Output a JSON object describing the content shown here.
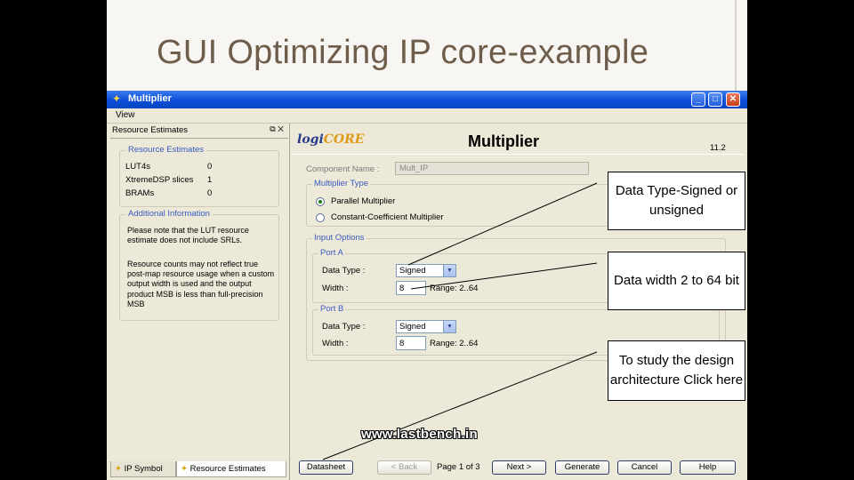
{
  "slide": {
    "title": "GUI Optimizing IP core-example"
  },
  "window": {
    "title": "Multiplier",
    "controls": {
      "minimize": "_",
      "maximize": "□",
      "close": "✕"
    },
    "menu": [
      "View"
    ]
  },
  "left_panel": {
    "header": "Resource Estimates",
    "header_icons": "⧉ ✕",
    "estimates": {
      "legend": "Resource Estimates",
      "rows": [
        {
          "label": "LUT4s",
          "value": "0"
        },
        {
          "label": "XtremeDSP slices",
          "value": "1"
        },
        {
          "label": "BRAMs",
          "value": "0"
        }
      ]
    },
    "info": {
      "legend": "Additional Information",
      "note1": "Please note that the LUT resource estimate does not include SRLs.",
      "note2": "Resource counts may not reflect true post-map resource usage when a custom output width is used and the output product MSB is less than full-precision MSB"
    },
    "tabs": [
      {
        "label": "IP Symbol"
      },
      {
        "label": "Resource Estimates"
      }
    ]
  },
  "main": {
    "logo_a": "logi",
    "logo_b": "CORE",
    "title": "Multiplier",
    "version": "11.2",
    "component_name_label": "Component Name :",
    "component_name_value": "Mult_IP",
    "multiplier_type": {
      "legend": "Multiplier Type",
      "options": [
        {
          "label": "Parallel Multiplier",
          "selected": true
        },
        {
          "label": "Constant-Coefficient Multiplier",
          "selected": false
        }
      ]
    },
    "input_options": {
      "legend": "Input Options",
      "port_a": {
        "legend": "Port A",
        "data_type_label": "Data Type :",
        "data_type_value": "Signed",
        "width_label": "Width :",
        "width_value": "8",
        "range": "Range: 2..64"
      },
      "port_b": {
        "legend": "Port B",
        "data_type_label": "Data Type :",
        "data_type_value": "Signed",
        "width_label": "Width :",
        "width_value": "8",
        "range": "Range: 2..64"
      }
    }
  },
  "bottom_bar": {
    "datasheet": "Datasheet",
    "back": "< Back",
    "page": "Page 1 of 3",
    "next": "Next >",
    "generate": "Generate",
    "cancel": "Cancel",
    "help": "Help"
  },
  "callouts": {
    "data_type": "Data Type-Signed or unsigned",
    "data_width": "Data width 2 to 64 bit",
    "datasheet": "To study the design architecture Click here"
  },
  "watermark": "www.lastbench.in",
  "colors": {
    "titlebar": "#0a4fd6",
    "panel": "#ece9d8",
    "legend_text": "#3a5ac0",
    "slide_title": "#6f5d4b"
  }
}
